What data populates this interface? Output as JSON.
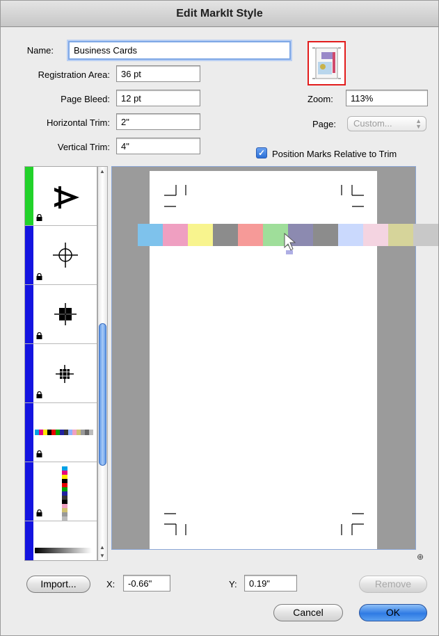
{
  "window": {
    "title": "Edit MarkIt Style"
  },
  "form": {
    "name_label": "Name:",
    "name_value": "Business Cards",
    "registration_label": "Registration Area:",
    "registration_value": "36 pt",
    "bleed_label": "Page Bleed:",
    "bleed_value": "12 pt",
    "htrim_label": "Horizontal Trim:",
    "htrim_value": "2\"",
    "vtrim_label": "Vertical Trim:",
    "vtrim_value": "4\""
  },
  "zoom": {
    "label": "Zoom:",
    "value": "113%"
  },
  "page_select": {
    "label": "Page:",
    "value": "Custom..."
  },
  "position_marks": {
    "label": "Position Marks Relative to Trim",
    "checked": true
  },
  "sidebar": {
    "items": [
      {
        "name": "text-mark",
        "color": "#22d22a"
      },
      {
        "name": "registration-target",
        "color": "#1414e0"
      },
      {
        "name": "star-target",
        "color": "#1414e0"
      },
      {
        "name": "grid-target",
        "color": "#1414e0"
      },
      {
        "name": "horizontal-color-bar",
        "color": "#1414e0"
      },
      {
        "name": "vertical-color-bar",
        "color": "#1414e0"
      },
      {
        "name": "gradient-bar",
        "color": "#1414e0"
      }
    ]
  },
  "color_bar": [
    "#7ec2ec",
    "#ef9fc1",
    "#f8f48e",
    "#8c8c8c",
    "#f69a98",
    "#9fde9a",
    "#8c8ab0",
    "#8c8c8c",
    "#cad9fd",
    "#f4d4e1",
    "#d6d49a",
    "#c8c8c8"
  ],
  "coords": {
    "x_label": "X:",
    "x_value": "-0.66\"",
    "y_label": "Y:",
    "y_value": "0.19\""
  },
  "buttons": {
    "import": "Import...",
    "remove": "Remove",
    "cancel": "Cancel",
    "ok": "OK"
  },
  "colors": {
    "accent": "#2f7be4",
    "highlight": "#e21b1b"
  }
}
